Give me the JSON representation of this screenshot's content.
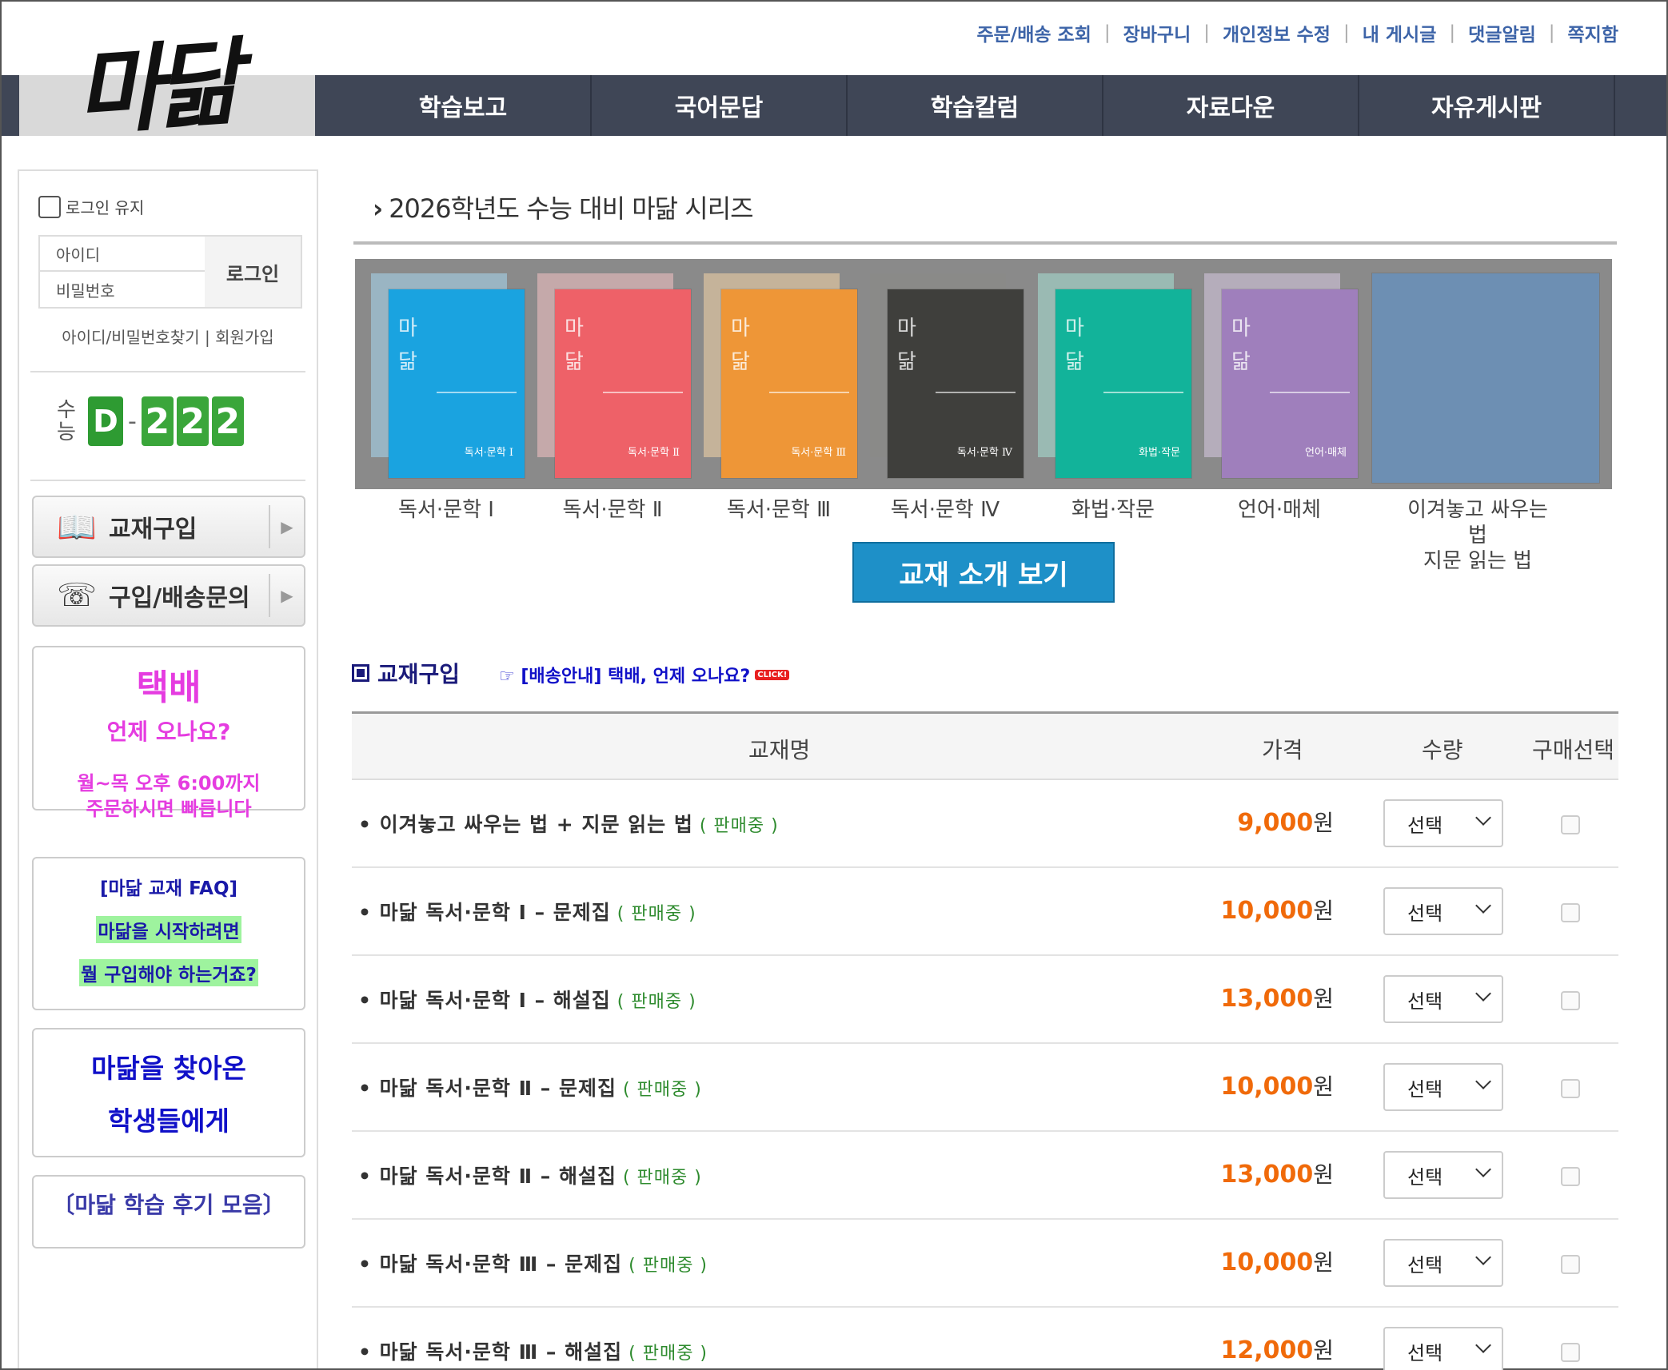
{
  "brand": {
    "logo_text": "마닮"
  },
  "top_links": [
    "주문/배송 조회",
    "장바구니",
    "개인정보 수정",
    "내 게시글",
    "댓글알림",
    "쪽지함"
  ],
  "nav": [
    "학습보고",
    "국어문답",
    "학습칼럼",
    "자료다운",
    "자유게시판"
  ],
  "sidebar": {
    "keep_login": "로그인 유지",
    "id_placeholder": "아이디",
    "pw_placeholder": "비밀번호",
    "login_button": "로그인",
    "find_links": "아이디/비밀번호찾기 | 회원가입",
    "dday": {
      "label_1": "수",
      "label_2": "능",
      "d": "D",
      "dash": "-",
      "digits": [
        "2",
        "2",
        "2"
      ]
    },
    "menu": [
      {
        "label": "교재구입",
        "icon": "book-icon",
        "glyph": "📖"
      },
      {
        "label": "구입/배송문의",
        "icon": "phone-icon",
        "glyph": "☏"
      }
    ],
    "delivery_box": {
      "title": "택배",
      "subtitle": "언제 오나요?",
      "line1": "월~목 오후 6:00까지",
      "line2": "주문하시면 빠릅니다"
    },
    "faq_box": {
      "title": "[마닮 교재 FAQ]",
      "line1": "마닮을 시작하려면",
      "line2": "뭘 구입해야 하는거죠?"
    },
    "students_box": {
      "line1": "마닮을 찾아온",
      "line2": "학생들에게"
    },
    "review_box": {
      "label": "〔마닮 학습 후기 모음〕"
    }
  },
  "series": {
    "title": "2026학년도 수능 대비 마닮 시리즈",
    "books": [
      {
        "label": "독서·문학 Ⅰ",
        "cover_sub": "독서·문학 Ⅰ",
        "color": "#1aa3e0",
        "back": "#a8d8f2"
      },
      {
        "label": "독서·문학 Ⅱ",
        "cover_sub": "독서·문학 Ⅱ",
        "color": "#ee6168",
        "back": "#f5c2c4"
      },
      {
        "label": "독서·문학 Ⅲ",
        "cover_sub": "독서·문학 Ⅲ",
        "color": "#ee9637",
        "back": "#f5d6a8"
      },
      {
        "label": "독서·문학 Ⅳ",
        "cover_sub": "독서·문학 Ⅳ",
        "color": "#3f3f3c",
        "back": "#8a8a86"
      },
      {
        "label": "화법·작문",
        "cover_sub": "화법·작문",
        "color": "#12b39a",
        "back": "#a8e2d6"
      },
      {
        "label": "언어·매체",
        "cover_sub": "언어·매체",
        "color": "#9f7fbc",
        "back": "#d8cbe4"
      }
    ],
    "last_book": {
      "label_line1": "이겨놓고 싸우는 법",
      "label_line2": "지문 읽는 법",
      "color": "#6d8fb3"
    },
    "intro_button": "교재 소개 보기"
  },
  "purchase": {
    "title": "교재구입",
    "shipping_link": "☞ [배송안내] 택배, 언제 오나요?",
    "click_badge": "CLICK!",
    "columns": {
      "name": "교재명",
      "price": "가격",
      "qty": "수량",
      "select": "구매선택"
    },
    "rows": [
      {
        "name": "• 이겨놓고 싸우는 법 + 지문 읽는 법",
        "status": "( 판매중 )",
        "price": "9,000",
        "won": "원",
        "qty": "선택"
      },
      {
        "name": "• 마닮 독서·문학 Ⅰ – 문제집",
        "status": "( 판매중 )",
        "price": "10,000",
        "won": "원",
        "qty": "선택"
      },
      {
        "name": "• 마닮 독서·문학 Ⅰ – 해설집",
        "status": "( 판매중 )",
        "price": "13,000",
        "won": "원",
        "qty": "선택"
      },
      {
        "name": "• 마닮 독서·문학 Ⅱ – 문제집",
        "status": "( 판매중 )",
        "price": "10,000",
        "won": "원",
        "qty": "선택"
      },
      {
        "name": "• 마닮 독서·문학 Ⅱ – 해설집",
        "status": "( 판매중 )",
        "price": "13,000",
        "won": "원",
        "qty": "선택"
      },
      {
        "name": "• 마닮 독서·문학 Ⅲ – 문제집",
        "status": "( 판매중 )",
        "price": "10,000",
        "won": "원",
        "qty": "선택"
      },
      {
        "name": "• 마닮 독서·문학 Ⅲ – 해설집",
        "status": "( 판매중 )",
        "price": "12,000",
        "won": "원",
        "qty": "선택"
      }
    ]
  }
}
